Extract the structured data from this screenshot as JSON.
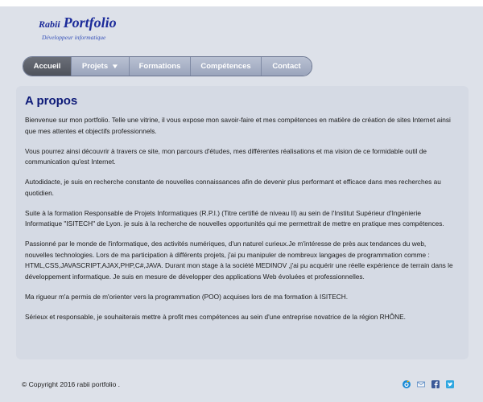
{
  "header": {
    "logo_first": "Rabii",
    "logo_second": "Portfolio",
    "logo_subtitle": "Développeur informatique"
  },
  "nav": {
    "items": [
      {
        "label": "Accueil",
        "active": true
      },
      {
        "label": "Projets",
        "dropdown": true
      },
      {
        "label": "Formations"
      },
      {
        "label": "Compétences"
      },
      {
        "label": "Contact"
      }
    ]
  },
  "main": {
    "title": "A propos",
    "paragraphs": [
      "Bienvenue sur mon portfolio. Telle une vitrine, il vous expose mon savoir-faire et mes compétences en matière de création de sites Internet ainsi que mes attentes et objectifs professionnels.",
      "Vous pourrez ainsi découvrir à travers ce site, mon parcours d'études, mes différentes réalisations et ma vision de ce formidable outil de communication qu'est Internet.",
      "Autodidacte, je suis en recherche constante de nouvelles connaissances afin de devenir plus performant et efficace dans mes recherches au quotidien.",
      "Suite à la formation Responsable de Projets Informatiques (R.P.I.) (Titre certifié de niveau II) au sein de l'Institut Supérieur d'Ingénierie Informatique \"ISITECH\" de Lyon. je suis à la recherche de nouvelles opportunités qui me permettrait de mettre en pratique mes compétences.",
      "Passionné par le monde de l'informatique, des activités numériques, d'un naturel curieux.Je m'intéresse de près aux tendances du web, nouvelles technologies. Lors de ma participation à différents projets, j'ai pu manipuler de nombreux langages de programmation comme : HTML,CSS,JAVASCRIPT,AJAX,PHP,C#,JAVA. Durant mon stage à la société MEDINOV ,j'ai pu acquérir une réelle expérience de terrain dans le développement informatique. Je suis en mesure de développer des applications Web évoluées et professionnelles.",
      "Ma rigueur m'a permis de m'orienter vers la programmation (POO) acquises lors de ma formation à ISITECH.",
      "Sérieux et responsable, je souhaiterais mettre à profit mes compétences au sein d'une entreprise novatrice de la région RHÔNE."
    ]
  },
  "footer": {
    "copyright": "© Copyright 2016 rabii portfolio .",
    "social_icons": [
      "viadeo-icon",
      "mail-icon",
      "facebook-icon",
      "twitter-icon"
    ]
  },
  "colors": {
    "title": "#0d1a78",
    "logo": "#1c2b9a",
    "nav_active": "#4f535c",
    "nav_default": "#9aa4bc",
    "page_bg": "#dde1e9",
    "card_bg": "#d5dae4"
  }
}
